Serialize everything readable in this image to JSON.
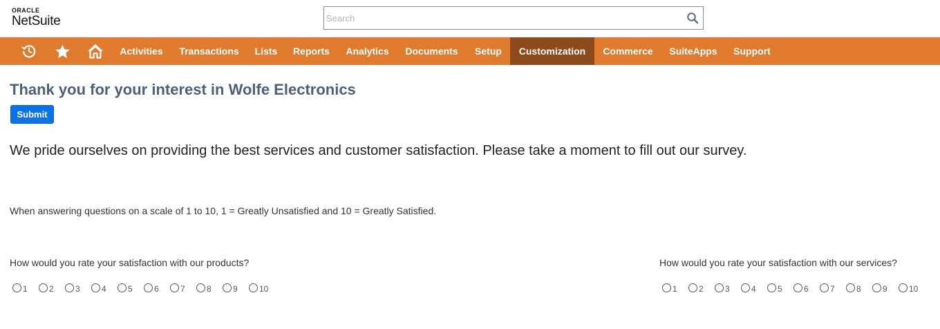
{
  "brand": {
    "oracle": "ORACLE",
    "product": "NetSuite"
  },
  "search": {
    "placeholder": "Search"
  },
  "nav": {
    "icons": [
      "recent-icon",
      "star-icon",
      "home-icon"
    ],
    "items": [
      {
        "label": "Activities",
        "active": false
      },
      {
        "label": "Transactions",
        "active": false
      },
      {
        "label": "Lists",
        "active": false
      },
      {
        "label": "Reports",
        "active": false
      },
      {
        "label": "Analytics",
        "active": false
      },
      {
        "label": "Documents",
        "active": false
      },
      {
        "label": "Setup",
        "active": false
      },
      {
        "label": "Customization",
        "active": true
      },
      {
        "label": "Commerce",
        "active": false
      },
      {
        "label": "SuiteApps",
        "active": false
      },
      {
        "label": "Support",
        "active": false
      }
    ],
    "bar_color": "#e07b2e",
    "active_color": "#8d4a1c"
  },
  "form": {
    "title": "Thank you for your interest in Wolfe Electronics",
    "submit_label": "Submit",
    "intro": "We pride ourselves on providing the best services and customer satisfaction. Please take a moment to fill out our survey.",
    "scale_note": "When answering questions on a scale of 1 to 10, 1 = Greatly Unsatisfied and 10 = Greatly Satisfied.",
    "questions": [
      {
        "text": "How would you rate your satisfaction with our products?",
        "options": [
          "1",
          "2",
          "3",
          "4",
          "5",
          "6",
          "7",
          "8",
          "9",
          "10"
        ],
        "selected": null
      },
      {
        "text": "How would you rate your satisfaction with our services?",
        "options": [
          "1",
          "2",
          "3",
          "4",
          "5",
          "6",
          "7",
          "8",
          "9",
          "10"
        ],
        "selected": null
      }
    ]
  }
}
